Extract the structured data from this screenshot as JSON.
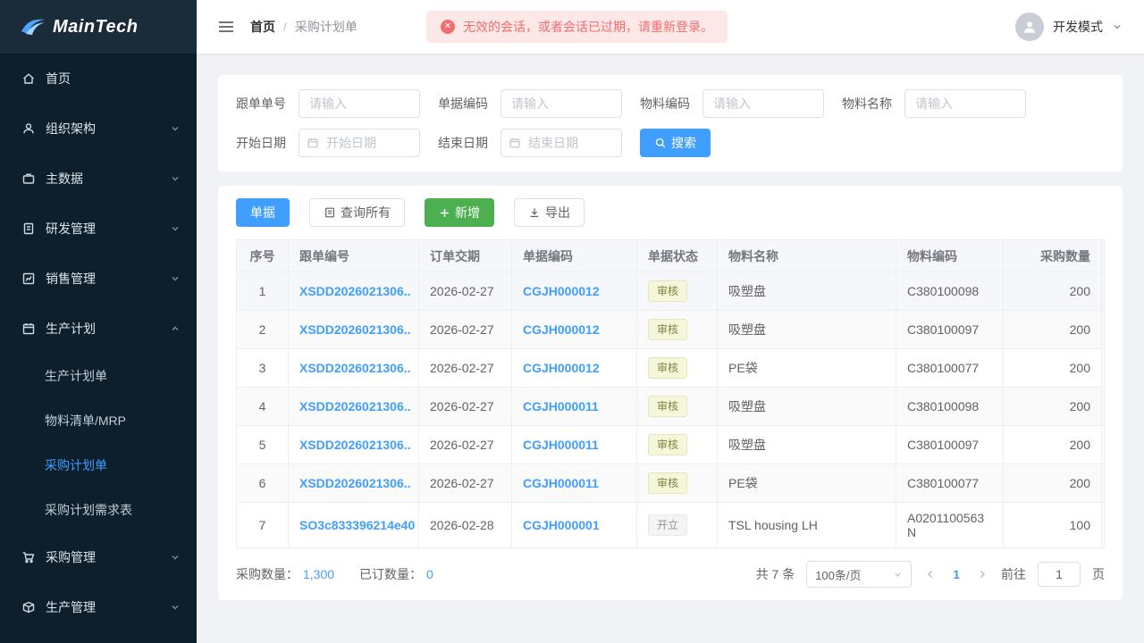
{
  "brand": {
    "name": "MainTech"
  },
  "colors": {
    "primary": "#409eff",
    "success": "#4caf50",
    "danger": "#f56c6c",
    "sidebar_bg": "#0d1f2d",
    "active_link": "#409eff"
  },
  "sidebar": {
    "items": [
      {
        "label": "首页"
      },
      {
        "label": "组织架构"
      },
      {
        "label": "主数据"
      },
      {
        "label": "研发管理"
      },
      {
        "label": "销售管理"
      },
      {
        "label": "生产计划"
      },
      {
        "label": "采购管理"
      },
      {
        "label": "生产管理"
      }
    ],
    "submenu": [
      {
        "label": "生产计划单"
      },
      {
        "label": "物料清单/MRP"
      },
      {
        "label": "采购计划单"
      },
      {
        "label": "采购计划需求表"
      }
    ],
    "active_submenu": "采购计划单"
  },
  "header": {
    "breadcrumb_home": "首页",
    "breadcrumb_sep": "/",
    "breadcrumb_current": "采购计划单",
    "alert_message": "无效的会话，或者会话已过期，请重新登录。",
    "alert_icon_glyph": "✕",
    "user_mode": "开发模式"
  },
  "filters": {
    "fields": [
      {
        "label": "跟单单号",
        "placeholder": "请输入",
        "value": ""
      },
      {
        "label": "单据编码",
        "placeholder": "请输入",
        "value": ""
      },
      {
        "label": "物料编码",
        "placeholder": "请输入",
        "value": ""
      },
      {
        "label": "物料名称",
        "placeholder": "请输入",
        "value": ""
      }
    ],
    "date_fields": [
      {
        "label": "开始日期",
        "placeholder": "开始日期",
        "value": ""
      },
      {
        "label": "结束日期",
        "placeholder": "结束日期",
        "value": ""
      }
    ],
    "search_label": "搜索"
  },
  "toolbar": {
    "docs_label": "单据",
    "query_all_label": "查询所有",
    "add_label": "新增",
    "export_label": "导出"
  },
  "table": {
    "columns": [
      "序号",
      "跟单编号",
      "订单交期",
      "单据编码",
      "单据状态",
      "物料名称",
      "物料编码",
      "采购数量"
    ],
    "rows": [
      {
        "no": "1",
        "order_no": "XSDD2026021306..",
        "delivery": "2026-02-27",
        "doc": "CGJH000012",
        "status": "审核",
        "status_type": "review",
        "material": "吸塑盘",
        "code": "C380100098",
        "qty": "200"
      },
      {
        "no": "2",
        "order_no": "XSDD2026021306..",
        "delivery": "2026-02-27",
        "doc": "CGJH000012",
        "status": "审核",
        "status_type": "review",
        "material": "吸塑盘",
        "code": "C380100097",
        "qty": "200"
      },
      {
        "no": "3",
        "order_no": "XSDD2026021306..",
        "delivery": "2026-02-27",
        "doc": "CGJH000012",
        "status": "审核",
        "status_type": "review",
        "material": "PE袋",
        "code": "C380100077",
        "qty": "200"
      },
      {
        "no": "4",
        "order_no": "XSDD2026021306..",
        "delivery": "2026-02-27",
        "doc": "CGJH000011",
        "status": "审核",
        "status_type": "review",
        "material": "吸塑盘",
        "code": "C380100098",
        "qty": "200"
      },
      {
        "no": "5",
        "order_no": "XSDD2026021306..",
        "delivery": "2026-02-27",
        "doc": "CGJH000011",
        "status": "审核",
        "status_type": "review",
        "material": "吸塑盘",
        "code": "C380100097",
        "qty": "200"
      },
      {
        "no": "6",
        "order_no": "XSDD2026021306..",
        "delivery": "2026-02-27",
        "doc": "CGJH000011",
        "status": "审核",
        "status_type": "review",
        "material": "PE袋",
        "code": "C380100077",
        "qty": "200"
      },
      {
        "no": "7",
        "order_no": "SO3c833396214e40",
        "delivery": "2026-02-28",
        "doc": "CGJH000001",
        "status": "开立",
        "status_type": "open",
        "material": "TSL housing LH",
        "code": "A0201100563N",
        "qty": "100"
      }
    ]
  },
  "summary": {
    "purchase_qty_label": "采购数量：",
    "purchase_qty": "1,300",
    "ordered_qty_label": "已订数量：",
    "ordered_qty": "0"
  },
  "pagination": {
    "total": "共 7 条",
    "page_size": "100条/页",
    "current_page": "1",
    "goto_label": "前往",
    "goto_value": "1",
    "page_suffix": "页"
  }
}
